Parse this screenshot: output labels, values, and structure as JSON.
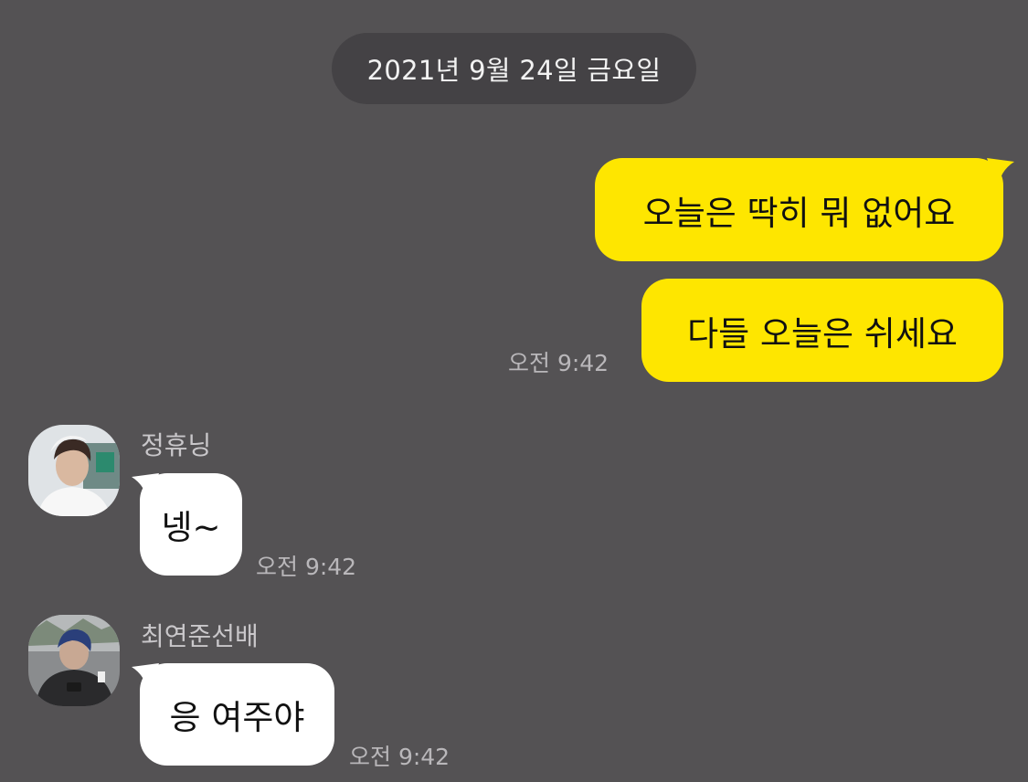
{
  "date_divider": "2021년 9월 24일 금요일",
  "colors": {
    "background": "#545254",
    "my_bubble": "#fee600",
    "their_bubble": "#ffffff",
    "date_pill": "#444245",
    "timestamp": "#b9b7ba"
  },
  "outgoing": {
    "messages": [
      {
        "text": "오늘은 딱히 뭐 없어요"
      },
      {
        "text": "다들 오늘은 쉬세요"
      }
    ],
    "time": "오전 9:42"
  },
  "incoming": [
    {
      "sender": "정휴닝",
      "avatar_icon": "profile-photo",
      "text": "넹~",
      "time": "오전 9:42"
    },
    {
      "sender": "최연준선배",
      "avatar_icon": "profile-photo",
      "text": "응 여주야",
      "time": "오전 9:42"
    }
  ]
}
